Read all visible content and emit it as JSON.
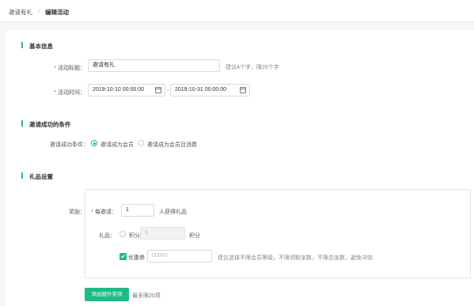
{
  "breadcrumb": {
    "parent": "邀请有礼",
    "separator": "/",
    "current": "编辑活动"
  },
  "basic": {
    "title": "基本信息",
    "name_label": "活动标题：",
    "name_value": "邀请有礼",
    "name_hint": "建议4个字，限20个字",
    "time_label": "活动时间：",
    "start_time": "2019-10-10 00:00:00",
    "time_separator": "-",
    "end_time": "2019-10-31 00:00:00"
  },
  "condition": {
    "title": "邀请成功的条件",
    "label": "邀请成功条件：",
    "options": [
      "邀请成为会员",
      "邀请成为会员且消费"
    ],
    "selected": "邀请成为会员"
  },
  "gift": {
    "title": "礼品设置",
    "reward_label": "奖励：",
    "per_invite_label": "每邀请：",
    "per_invite_value": "1",
    "per_invite_suffix": "人获得礼品",
    "gift_label": "礼品：",
    "points_option": "积分",
    "points_value": "1",
    "points_unit": "积分",
    "coupon_option": "优惠券",
    "coupon_checked": true,
    "coupon_placeholder": "00000",
    "coupon_hint": "建议选择不限会员等级，不限领取张数，不限总张数，避免冲突"
  },
  "actions": {
    "add_label": "添加额外奖项",
    "add_hint": "最多限20项"
  },
  "colors": {
    "accent": "#1dbb86",
    "required": "#f04848"
  }
}
